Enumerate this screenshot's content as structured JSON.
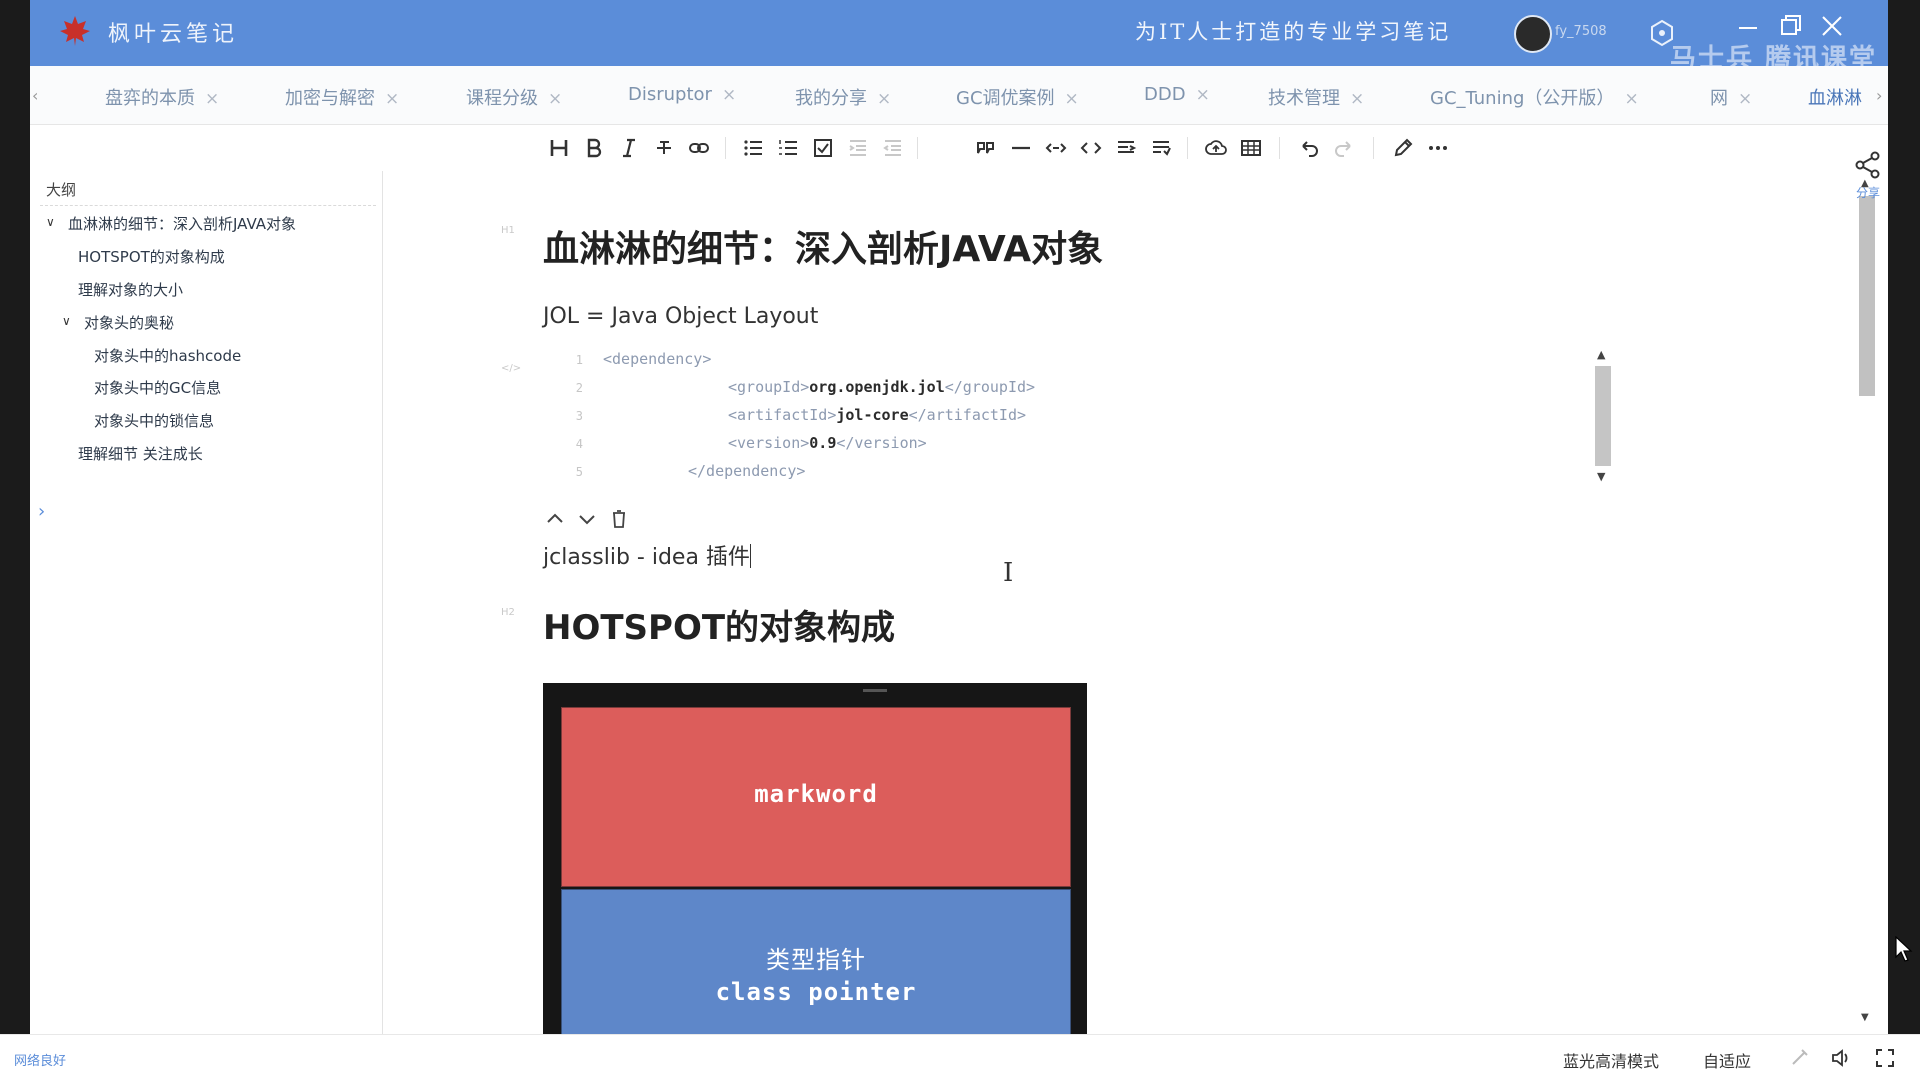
{
  "titlebar": {
    "app_title": "枫叶云笔记",
    "slogan": "为IT人士打造的专业学习笔记",
    "username": "fy_7508",
    "watermark": "马士兵 腾讯课堂",
    "accent_color": "#5b8dd9"
  },
  "tabs": [
    {
      "label": "盘弈的本质",
      "active": false
    },
    {
      "label": "加密与解密",
      "active": false
    },
    {
      "label": "课程分级",
      "active": false
    },
    {
      "label": "Disruptor",
      "active": false
    },
    {
      "label": "我的分享",
      "active": false
    },
    {
      "label": "GC调优案例",
      "active": false
    },
    {
      "label": "DDD",
      "active": false
    },
    {
      "label": "技术管理",
      "active": false
    },
    {
      "label": "GC_Tuning（公开版）",
      "active": false
    },
    {
      "label": "网",
      "active": false
    },
    {
      "label": "血淋淋",
      "active": true
    }
  ],
  "toolbar": {
    "icons": [
      "heading-icon",
      "bold-icon",
      "italic-icon",
      "strikethrough-icon",
      "link-icon",
      "bullet-list-icon",
      "numbered-list-icon",
      "checklist-icon",
      "indent-icon",
      "outdent-icon",
      "quote-icon",
      "divider-icon",
      "code-inline-icon",
      "code-block-icon",
      "align-icon",
      "wrap-icon",
      "upload-icon",
      "table-icon",
      "undo-icon",
      "redo-icon",
      "pen-icon",
      "more-icon"
    ]
  },
  "outline": {
    "title": "大纲",
    "items": [
      {
        "label": "血淋淋的细节：深入剖析JAVA对象",
        "level": 0,
        "expanded": true
      },
      {
        "label": "HOTSPOT的对象构成",
        "level": 1
      },
      {
        "label": "理解对象的大小",
        "level": 1
      },
      {
        "label": "对象头的奥秘",
        "level": 1,
        "expanded": true
      },
      {
        "label": "对象头中的hashcode",
        "level": 2
      },
      {
        "label": "对象头中的GC信息",
        "level": 2
      },
      {
        "label": "对象头中的锁信息",
        "level": 2
      },
      {
        "label": "理解细节 关注成长",
        "level": 1
      }
    ]
  },
  "doc": {
    "h1": "血淋淋的细节：深入剖析JAVA对象",
    "h1_marker": "H1",
    "code_marker": "</>",
    "h2_marker": "H2",
    "jol_line": "JOL = Java Object Layout",
    "code": {
      "lines": [
        {
          "num": "1",
          "open": "<dependency>",
          "value": "",
          "close": ""
        },
        {
          "num": "2",
          "open": "<groupId>",
          "value": "org.openjdk.jol",
          "close": "</groupId>"
        },
        {
          "num": "3",
          "open": "<artifactId>",
          "value": "jol-core",
          "close": "</artifactId>"
        },
        {
          "num": "4",
          "open": "<version>",
          "value": "0.9",
          "close": "</version>"
        },
        {
          "num": "5",
          "open": "</dependency>",
          "value": "",
          "close": ""
        }
      ]
    },
    "jclasslib_line": "jclasslib - idea 插件",
    "h2": "HOTSPOT的对象构成",
    "diagram": {
      "markword": "markword",
      "class_pointer_cn": "类型指针",
      "class_pointer_en": "class pointer",
      "markword_color": "#dc5d5b",
      "class_pointer_color": "#5e87c9"
    }
  },
  "share": {
    "label": "分享"
  },
  "statusbar": {
    "network": "网络良好",
    "quality": "蓝光高清模式",
    "fit": "自适应"
  }
}
